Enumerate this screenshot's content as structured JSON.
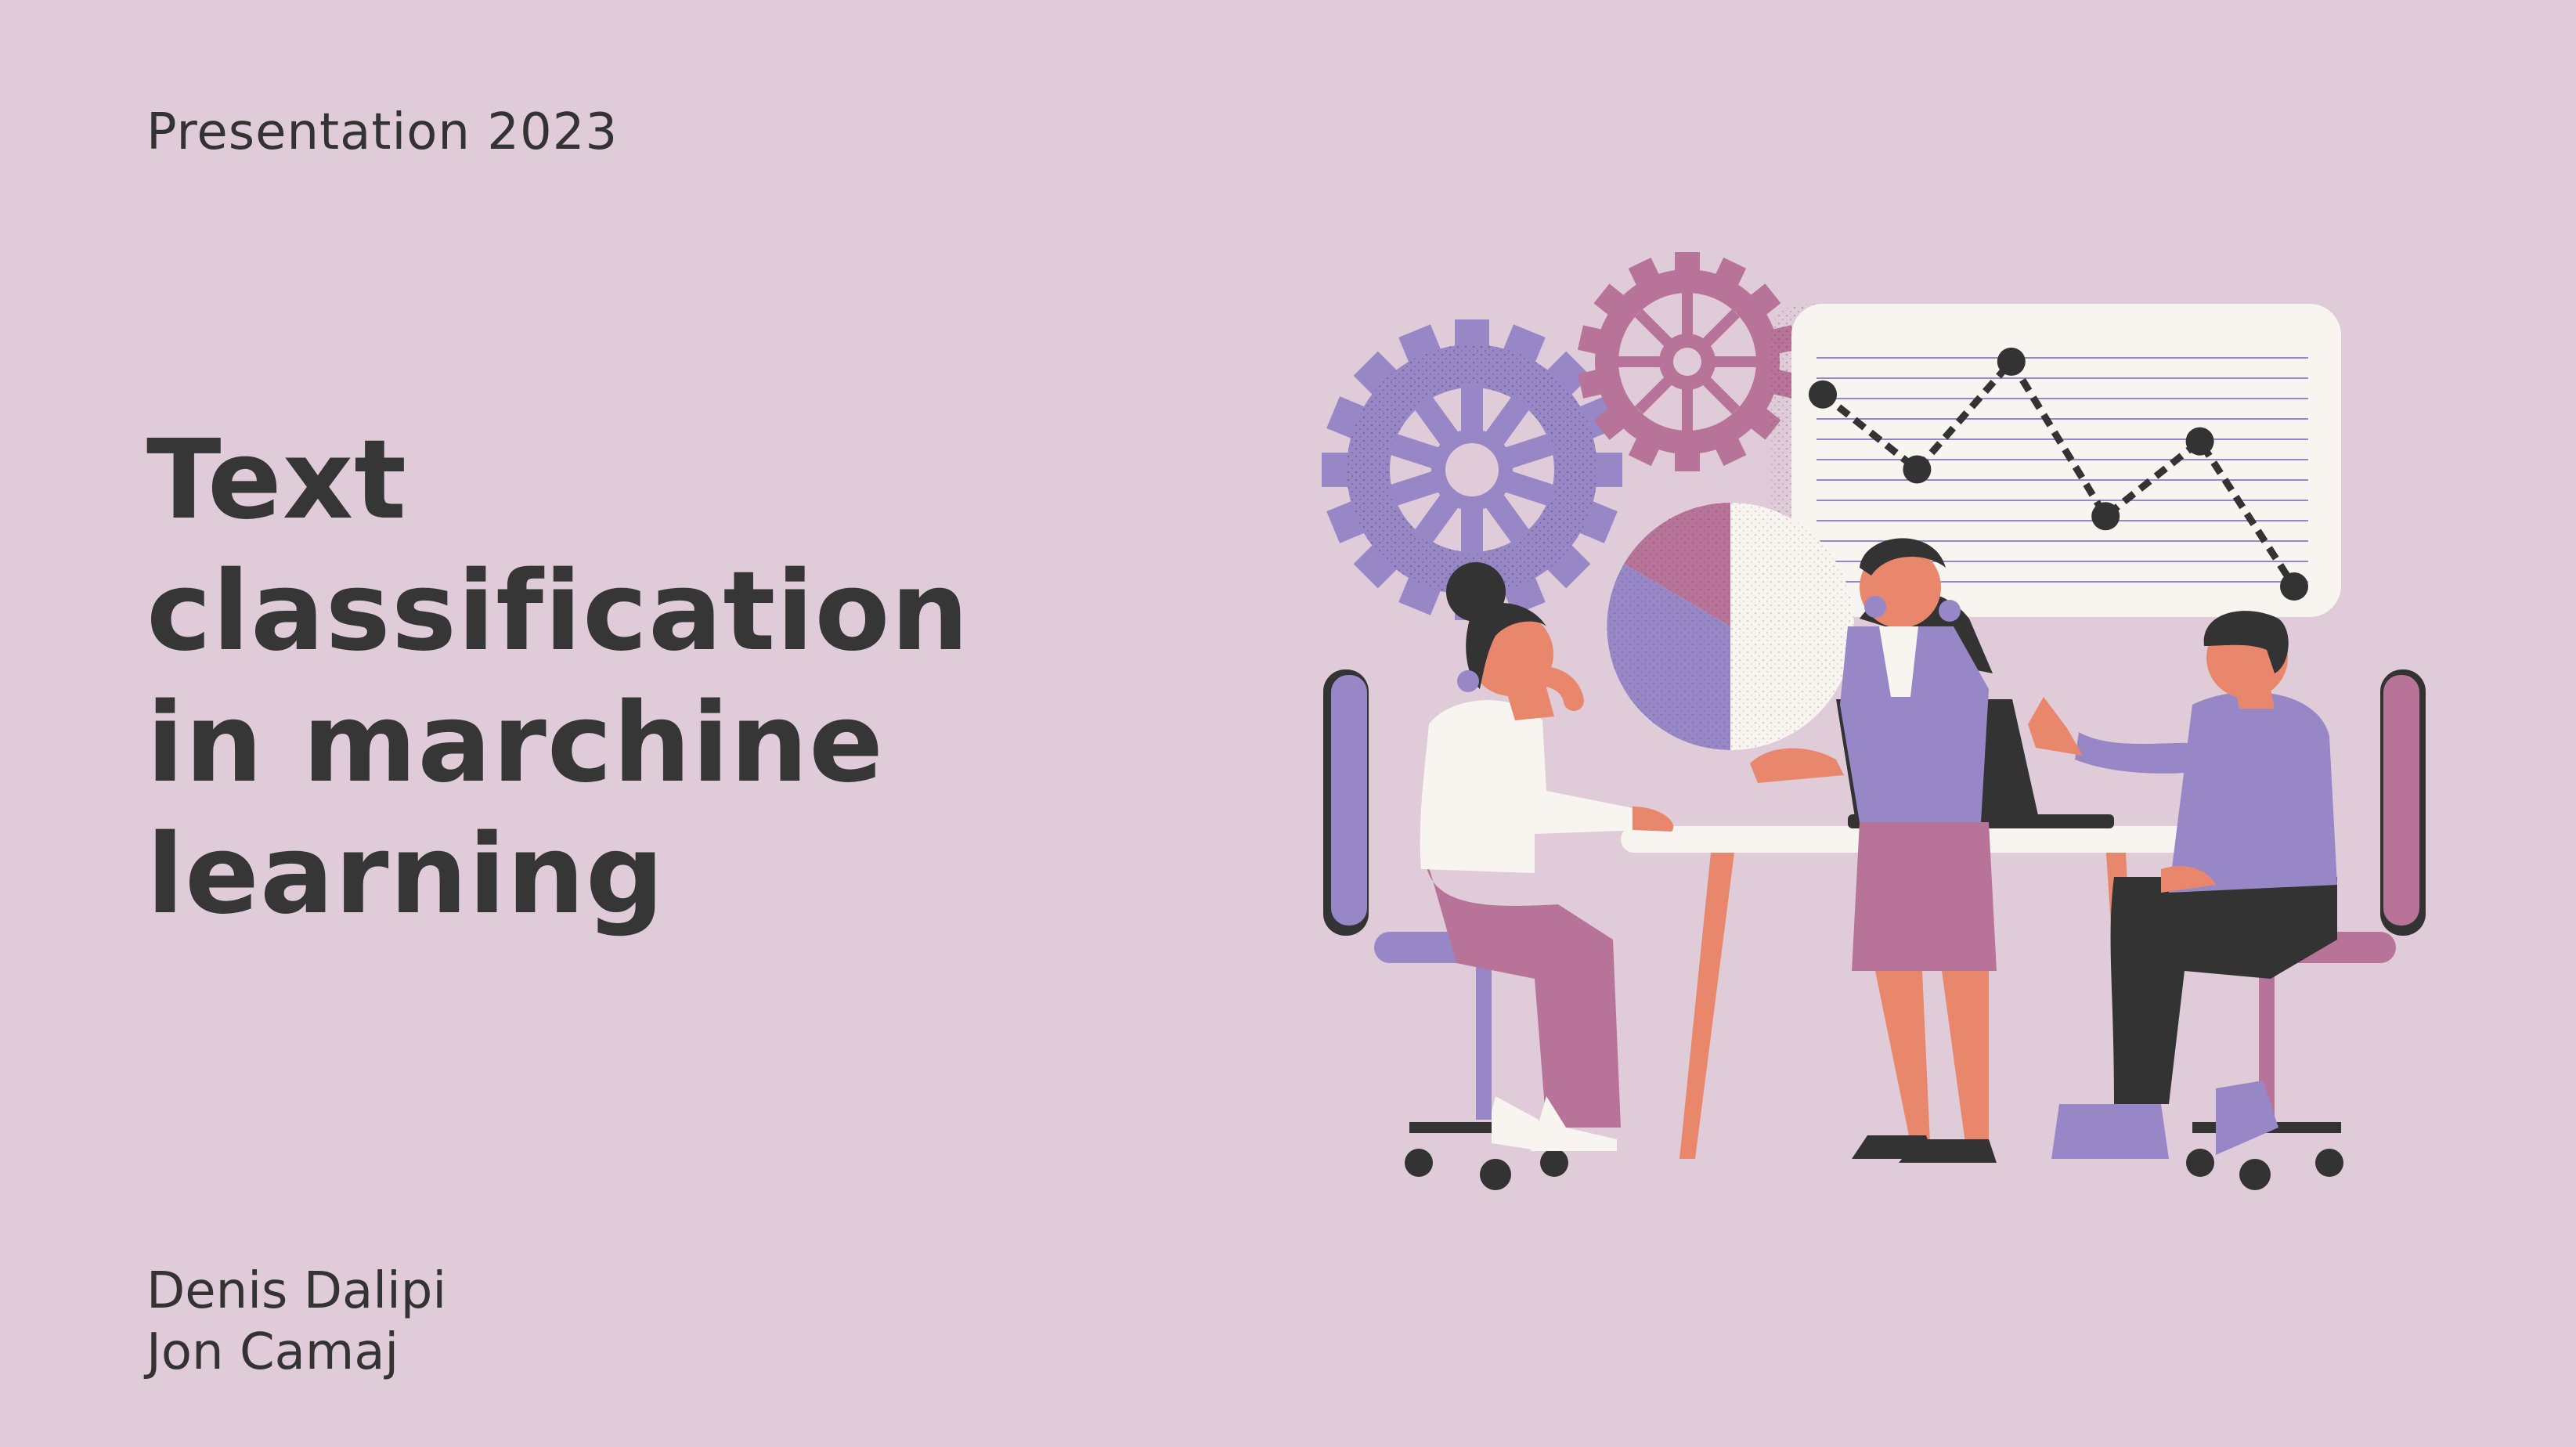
{
  "slide": {
    "eyebrow": "Presentation 2023",
    "title_lines": [
      "Text",
      "classification",
      "in marchine",
      "learning"
    ],
    "authors": [
      "Denis Dalipi",
      "Jon Camaj"
    ]
  },
  "colors": {
    "background": "#e0cbd8",
    "text": "#363636",
    "purple": "#9887c6",
    "mauve": "#b87399",
    "skin": "#e8876c",
    "cream": "#f8f5f1",
    "dark": "#333333"
  },
  "chart_data": {
    "type": "line",
    "x": [
      1,
      2,
      3,
      4,
      5,
      6
    ],
    "values": [
      4.2,
      2.6,
      4.9,
      1.6,
      3.2,
      0.1
    ],
    "ylim": [
      0,
      5.4
    ],
    "grid": true
  }
}
